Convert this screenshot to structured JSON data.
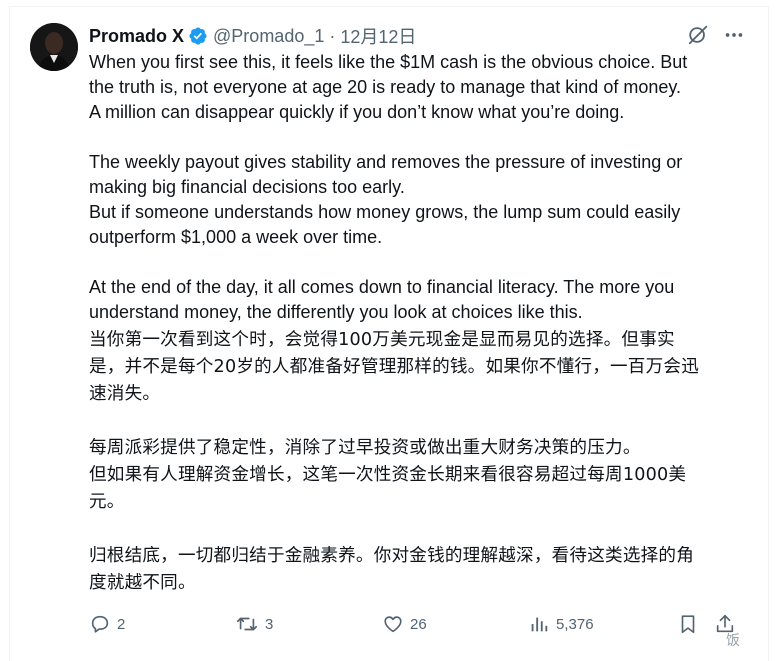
{
  "author": {
    "display_name": "Promado X",
    "handle": "@Promado_1",
    "separator": "·",
    "date": "12月12日"
  },
  "tweet": {
    "paragraphs_en": [
      [
        "When you first see this, it feels like the $1M cash is the obvious choice. But",
        "the truth is, not everyone at age 20 is ready to manage that kind of money.",
        "A million can disappear quickly if you don’t know what you’re doing."
      ],
      [
        "The weekly payout gives stability and removes the pressure of investing or",
        "making big financial decisions too early.",
        "But if someone understands how money grows, the lump sum could easily",
        "outperform $1,000 a week over time."
      ],
      [
        "At the end of the day, it all comes down to financial literacy. The more you",
        "understand money, the differently you look at choices like this."
      ]
    ],
    "paragraphs_zh": [
      [
        "当你第一次看到这个时，会觉得100万美元现金是显而易见的选择。但事实",
        "是，并不是每个20岁的人都准备好管理那样的钱。如果你不懂行，一百万会迅",
        "速消失。"
      ],
      [
        "每周派彩提供了稳定性，消除了过早投资或做出重大财务决策的压力。",
        "但如果有人理解资金增长，这笔一次性资金长期来看很容易超过每周1000美",
        "元。"
      ],
      [
        "归根结底，一切都归结于金融素养。你对金钱的理解越深，看待这类选择的角",
        "度就越不同。"
      ]
    ]
  },
  "actions": {
    "replies": "2",
    "reposts": "3",
    "likes": "26",
    "views": "5,376"
  },
  "icons": {
    "verified": "verified-badge-icon",
    "grok": "grok-icon",
    "more": "more-icon",
    "reply": "reply-icon",
    "repost": "repost-icon",
    "like": "like-icon",
    "views": "views-icon",
    "bookmark": "bookmark-icon",
    "share": "share-icon"
  },
  "colors": {
    "text": "#0f1419",
    "secondary": "#536471",
    "verified": "#1d9bf0",
    "border": "#eff3f4"
  },
  "watermark": "饭"
}
